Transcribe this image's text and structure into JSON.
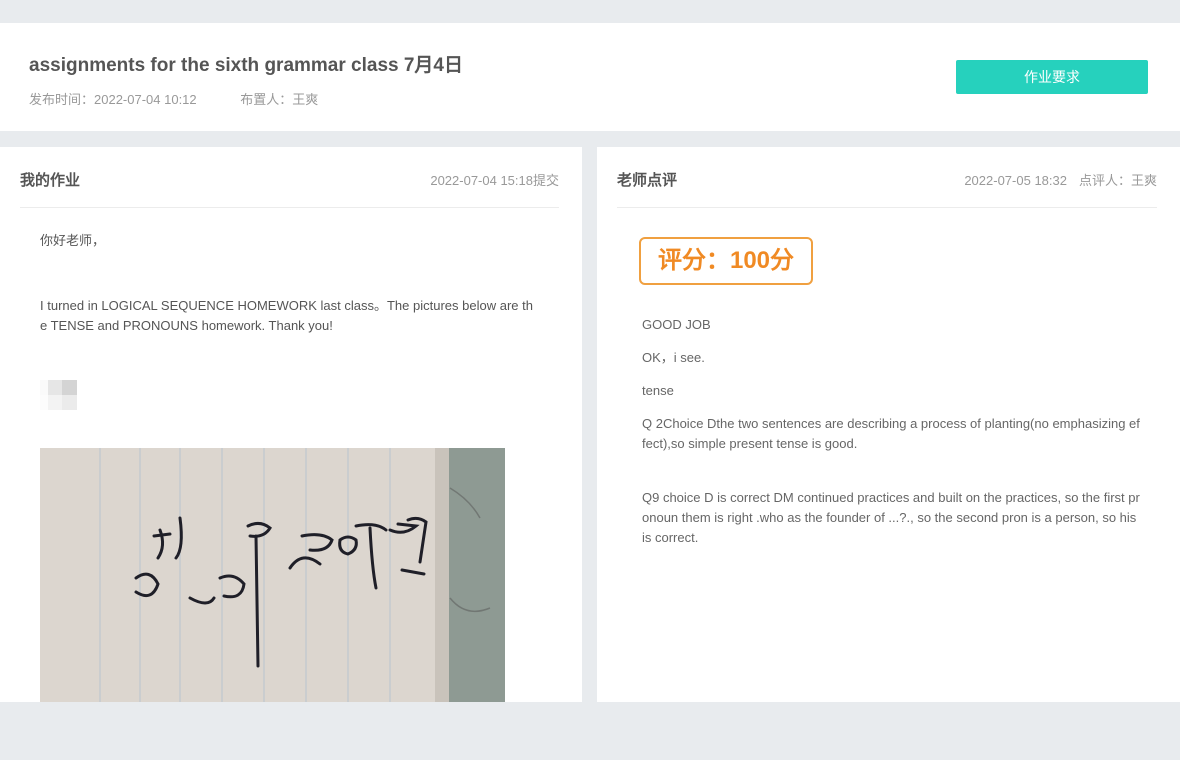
{
  "header": {
    "title": "assignments for the sixth grammar class 7月4日",
    "publish_time": "发布时间：2022-07-04 10:12",
    "assigner": "布置人：王爽",
    "requirements_button": "作业要求"
  },
  "my_homework": {
    "title": "我的作业",
    "submitted": "2022-07-04 15:18提交",
    "greeting": "你好老师，",
    "body": "I turned in LOGICAL SEQUENCE HOMEWORK last class。The pictures below are the TENSE and PRONOUNS homework. Thank you!",
    "photo_icon": "homework-photo-icon"
  },
  "teacher_review": {
    "title": "老师点评",
    "date": "2022-07-05 18:32",
    "reviewer": "点评人：王爽",
    "score": "评分：100分",
    "comments": [
      "GOOD JOB",
      "OK，i see.",
      "tense",
      "Q 2Choice Dthe two sentences are describing a process of planting(no emphasizing effect),so simple present tense is good.",
      "Q9 choice D is correct DM continued practices and built on the practices, so the first pronoun them is right .who as the founder of ...?., so the second pron is a person, so his is correct."
    ]
  },
  "colors": {
    "accent": "#26d1bd",
    "score": "#f08a24",
    "background": "#e8ebee"
  }
}
